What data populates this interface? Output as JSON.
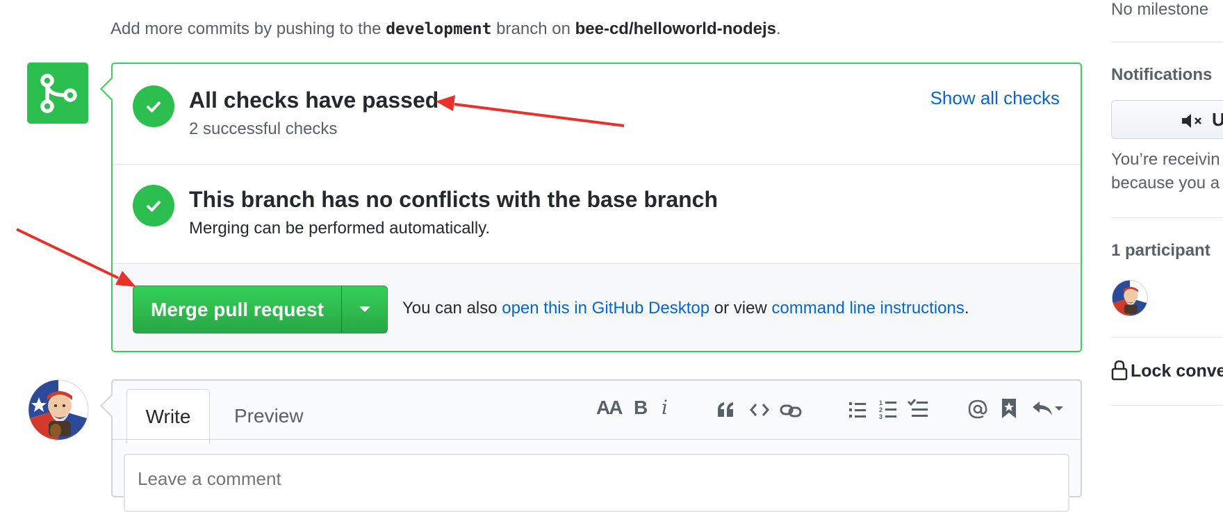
{
  "info": {
    "prefix": "Add more commits by pushing to the ",
    "branch": "development",
    "middle": " branch on ",
    "repo": "bee-cd/helloworld-nodejs",
    "suffix": "."
  },
  "checks": {
    "title": "All checks have passed",
    "subtitle": "2 successful checks",
    "show_all": "Show all checks"
  },
  "conflicts": {
    "title": "This branch has no conflicts with the base branch",
    "subtitle": "Merging can be performed automatically."
  },
  "merge": {
    "button": "Merge pull request",
    "also_prefix": "You can also ",
    "desktop_link": "open this in GitHub Desktop",
    "or_view": " or view ",
    "cli_link": "command line instructions",
    "suffix": "."
  },
  "comment": {
    "tab_write": "Write",
    "tab_preview": "Preview",
    "placeholder": "Leave a comment",
    "toolbar": [
      "header-icon",
      "bold-icon",
      "italic-icon",
      "quote-icon",
      "code-icon",
      "link-icon",
      "bullet-list-icon",
      "numbered-list-icon",
      "task-list-icon",
      "mention-icon",
      "saved-reply-icon",
      "reply-icon"
    ],
    "toolbar_labels": {
      "header": "AA",
      "bold": "B",
      "italic": "i"
    }
  },
  "sidebar": {
    "milestone": "No milestone",
    "notifications_heading": "Notifications",
    "unsubscribe_label": "U",
    "receiving_line1": "You’re receivin",
    "receiving_line2": "because you a",
    "participants": "1 participant",
    "lock": "Lock conve"
  },
  "colors": {
    "success_green": "#2cbe4e",
    "merge_border": "#34d058",
    "link_blue": "#0366d6",
    "annotation_red": "#e8312a"
  }
}
